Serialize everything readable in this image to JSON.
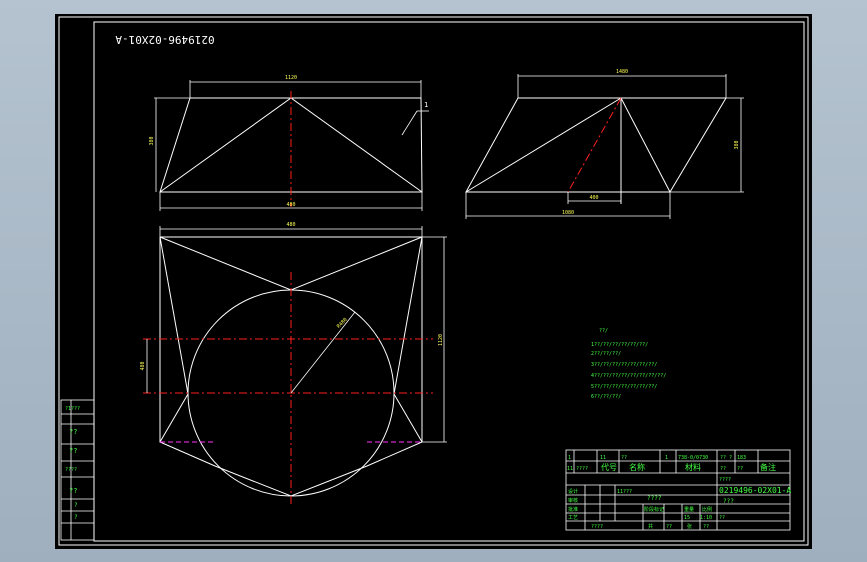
{
  "drawing": {
    "number_mirrored": "0219496-02X01-A",
    "number": "0219496-02X01-A",
    "part_label": "1",
    "question_marks": "???",
    "notes_title": "??/",
    "notes": [
      "1??/??/??/??/??/??/",
      "2??/??/??/",
      "3??/??/??/??/??/??/??/",
      "4??/??/??/??/??/??/??/??/",
      "5??/??/??/??/??/??/??/",
      "6??/??/??/"
    ]
  },
  "dimensions": {
    "front_top": "1120",
    "front_height": "380",
    "front_bottom": "480",
    "side_top": "1480",
    "side_height": "380",
    "side_small": "400",
    "side_bottom": "1080",
    "plan_top": "480",
    "plan_height": "1120",
    "plan_left": "480",
    "radius": "R480"
  },
  "side_panel": {
    "items": [
      "?1???",
      "??",
      "??",
      "????",
      "??",
      "?",
      "?"
    ]
  },
  "title_block": {
    "row1": [
      "1",
      "11",
      "??",
      "1",
      "738-0/0730",
      "?? ?",
      "183"
    ],
    "row2": [
      "11",
      "????",
      "代号",
      "名称",
      "材料",
      "??",
      "??",
      "备注"
    ],
    "header_small": "????",
    "drawing_number": "0219496-02X01-A",
    "drawing_name": "???",
    "labels": [
      "设计",
      "审核",
      "批准",
      "工艺"
    ],
    "code": "11???",
    "name_text": "????",
    "stage_label": "阶段标记",
    "weight_label": "重量",
    "scale_label": "比例",
    "weight_val": "15",
    "scale_val": "1:10",
    "sheet_label": "共",
    "sheet_label2": "张",
    "sheet_val": "??",
    "page_val": "??",
    "footer": "????",
    "approve_small": "??"
  }
}
